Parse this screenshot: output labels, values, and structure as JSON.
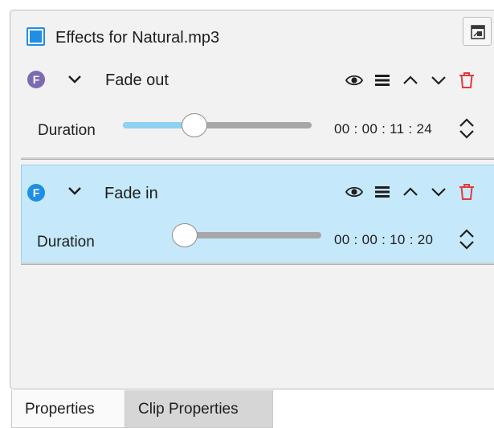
{
  "panel": {
    "title": "Effects for Natural.mp3",
    "checkbox_checked": true,
    "accent_color": "#1f8ee5"
  },
  "effects": [
    {
      "badge": "F",
      "badge_color": "#7b6bb3",
      "name": "Fade out",
      "selected": false,
      "duration_label": "Duration",
      "duration_slider_fraction": 0.36,
      "duration_value": "00 : 00 : 11 : 24",
      "icons": [
        "eye-icon",
        "menu-icon",
        "move-up-icon",
        "move-down-icon",
        "delete-icon"
      ]
    },
    {
      "badge": "F",
      "badge_color": "#1f8ee5",
      "name": "Fade in",
      "selected": true,
      "duration_label": "Duration",
      "duration_slider_fraction": 0.0,
      "duration_value": "00 : 00 : 10 : 20",
      "icons": [
        "eye-icon",
        "menu-icon",
        "move-up-icon",
        "move-down-icon",
        "delete-icon"
      ]
    }
  ],
  "tabs": [
    {
      "label": "Properties",
      "active": true
    },
    {
      "label": "Clip Properties",
      "active": false
    }
  ],
  "colors": {
    "delete_icon": "#e33a3a",
    "selected_row_bg": "#c5e8fa",
    "slider_fill": "#8ed2f2"
  }
}
